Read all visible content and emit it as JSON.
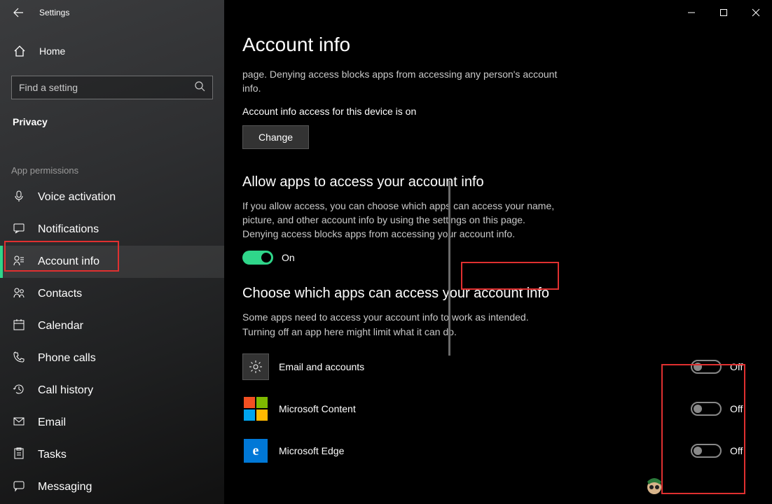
{
  "app_title": "Settings",
  "home_label": "Home",
  "search_placeholder": "Find a setting",
  "section_label": "Privacy",
  "group_label": "App permissions",
  "sidebar_items": [
    {
      "label": "Voice activation"
    },
    {
      "label": "Notifications"
    },
    {
      "label": "Account info"
    },
    {
      "label": "Contacts"
    },
    {
      "label": "Calendar"
    },
    {
      "label": "Phone calls"
    },
    {
      "label": "Call history"
    },
    {
      "label": "Email"
    },
    {
      "label": "Tasks"
    },
    {
      "label": "Messaging"
    }
  ],
  "page": {
    "title": "Account info",
    "intro_tail": "page. Denying access blocks apps from accessing any person's account info.",
    "device_status": "Account info access for this device is on",
    "change_btn": "Change",
    "section2_title": "Allow apps to access your account info",
    "section2_desc": "If you allow access, you can choose which apps can access your name, picture, and other account info by using the settings on this page. Denying access blocks apps from accessing your account info.",
    "main_toggle_label": "On",
    "section3_title": "Choose which apps can access your account info",
    "section3_desc": "Some apps need to access your account info to work as intended. Turning off an app here might limit what it can do.",
    "apps": [
      {
        "name": "Email and accounts",
        "state": "Off"
      },
      {
        "name": "Microsoft Content",
        "state": "Off"
      },
      {
        "name": "Microsoft Edge",
        "state": "Off"
      }
    ]
  }
}
